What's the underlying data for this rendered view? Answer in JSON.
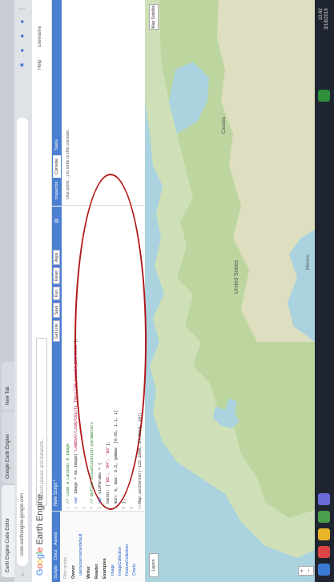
{
  "browser": {
    "tabs": [
      "Earth Engine Code Editor",
      "Google Earth Engine",
      "New Tab"
    ],
    "url": "code.earthengine.google.com"
  },
  "header": {
    "logo_google": [
      "G",
      "o",
      "o",
      "g",
      "l",
      "e"
    ],
    "logo_rest": " Earth Engine",
    "search_placeholder": "Search places and datasets...",
    "help_label": "Help",
    "account_label": "username"
  },
  "left_panel": {
    "tabs": [
      "Scripts",
      "Docs",
      "Assets"
    ],
    "items": [
      {
        "text": "Filter scripts...",
        "style": "plain"
      },
      {
        "text": "Owner",
        "style": "bold"
      },
      {
        "text": "users/username/default",
        "style": "link"
      },
      {
        "text": "Writer",
        "style": "bold"
      },
      {
        "text": "Reader",
        "style": "bold"
      },
      {
        "text": "Examples",
        "style": "bold"
      },
      {
        "text": "Image",
        "style": "plain"
      },
      {
        "text": "ImageCollection",
        "style": "plain"
      },
      {
        "text": "FeatureCollection",
        "style": "plain"
      },
      {
        "text": "Charts",
        "style": "plain"
      }
    ]
  },
  "editor": {
    "title": "New Script *",
    "buttons": [
      "Get Link",
      "Save",
      "Run",
      "Reset",
      "Apps"
    ],
    "lines": [
      {
        "n": "1",
        "parts": [
          {
            "t": "// Load a Landsat 8 image",
            "c": "c-grn"
          }
        ]
      },
      {
        "n": "2",
        "parts": [
          {
            "t": "var ",
            "c": "c-blue"
          },
          {
            "t": "image = ee.Image(",
            "c": ""
          },
          {
            "t": "'LANDSAT/LC08/C01/T1_TOA/LC08_044034_20140318'",
            "c": "c-red"
          },
          {
            "t": ");",
            "c": ""
          }
        ]
      },
      {
        "n": "3",
        "parts": [
          {
            "t": "",
            "c": ""
          }
        ]
      },
      {
        "n": "4",
        "parts": [
          {
            "t": "// Define visualization parameters",
            "c": "c-grn"
          }
        ]
      },
      {
        "n": "5",
        "parts": [
          {
            "t": "var ",
            "c": "c-blue"
          },
          {
            "t": "vizParams = {",
            "c": ""
          }
        ]
      },
      {
        "n": "6",
        "parts": [
          {
            "t": "  bands: [",
            "c": ""
          },
          {
            "t": "'B5', 'B4', 'B3'",
            "c": "c-red"
          },
          {
            "t": "],",
            "c": ""
          }
        ]
      },
      {
        "n": "7",
        "parts": [
          {
            "t": "  min: 0, max: 0.5, gamma: [0.95, 1.1, 1]",
            "c": ""
          }
        ]
      },
      {
        "n": "8",
        "parts": [
          {
            "t": "};",
            "c": ""
          }
        ]
      },
      {
        "n": "9",
        "parts": [
          {
            "t": "",
            "c": ""
          }
        ]
      },
      {
        "n": "10",
        "parts": [
          {
            "t": "Map.setCenter(-122.1899, 37.5010, 10);",
            "c": ""
          }
        ]
      }
    ]
  },
  "right_panel": {
    "tabs": [
      "Inspector",
      "Console",
      "Tasks"
    ],
    "active_tab": "Console",
    "message": "Use print(...) to write to this console."
  },
  "map": {
    "layers_label": "Layers",
    "maptype_label": "Map  Satellite",
    "zoom_in": "+",
    "zoom_out": "−",
    "labels": [
      "United States",
      "Mexico",
      "Canada"
    ]
  },
  "taskbar": {
    "time": "10:42",
    "date": "3/18/2019"
  },
  "colors": {
    "accent": "#4a7fd1",
    "annotation": "#b01818",
    "water": "#aad3df",
    "land": "#cfe0b8"
  }
}
